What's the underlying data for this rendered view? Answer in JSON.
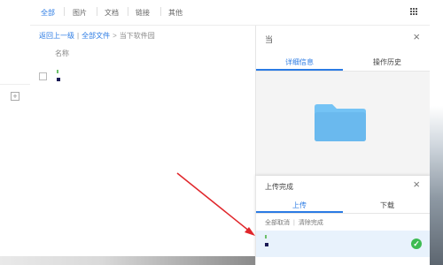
{
  "toolbar": {
    "filters": [
      {
        "label": "全部",
        "active": true
      },
      {
        "label": "图片",
        "active": false
      },
      {
        "label": "文档",
        "active": false
      },
      {
        "label": "链接",
        "active": false
      },
      {
        "label": "其他",
        "active": false
      }
    ],
    "view_toggle_icon": "grid-icon"
  },
  "breadcrumb": {
    "back": "返回上一级",
    "root": "全部文件",
    "sep": ">",
    "current": "当下软件园"
  },
  "list": {
    "column_name": "名称"
  },
  "detail_panel": {
    "title": "当",
    "close": "×",
    "tabs": [
      "详细信息",
      "操作历史"
    ],
    "active_tab": 0,
    "preview_icon": "folder-icon",
    "folder_color": "#74c3f5"
  },
  "upload_panel": {
    "title": "上传完成",
    "close": "×",
    "tabs": [
      "上传",
      "下载"
    ],
    "active_tab": 0,
    "actions": {
      "cancel_all": "全部取消",
      "sep": "|",
      "clear_done": "清除完成"
    },
    "status_icon": "check-icon",
    "status_color": "#3dbb52"
  },
  "colors": {
    "accent": "#2b7be4",
    "annotation_arrow": "#e0262b"
  }
}
